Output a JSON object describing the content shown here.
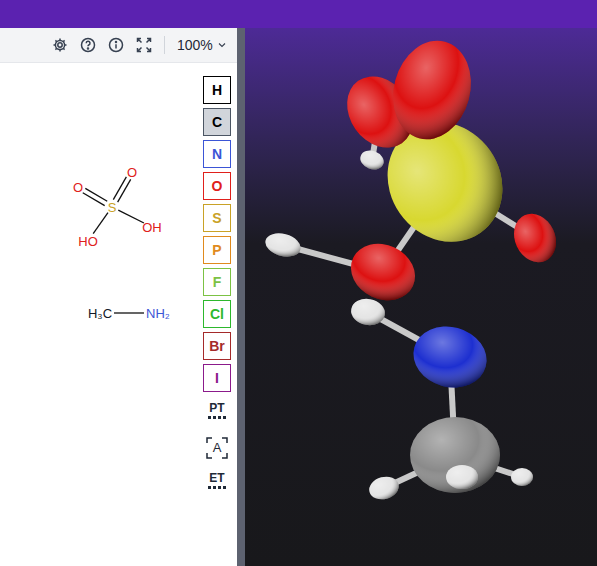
{
  "toolbar": {
    "zoom": "100%"
  },
  "structures": [
    {
      "atoms": [
        {
          "label": "S",
          "color": "#c9a227"
        },
        {
          "label": "O",
          "color": "#e0201b"
        },
        {
          "label": "O",
          "color": "#e0201b"
        },
        {
          "label": "OH",
          "color": "#e0201b"
        },
        {
          "label": "HO",
          "color": "#e0201b"
        }
      ],
      "bonds": [
        {
          "from": 0,
          "to": 1,
          "kind": "double"
        },
        {
          "from": 0,
          "to": 2,
          "kind": "double"
        },
        {
          "from": 0,
          "to": 3,
          "kind": "single"
        },
        {
          "from": 0,
          "to": 4,
          "kind": "single"
        }
      ]
    },
    {
      "atoms": [
        {
          "label": "H₃C",
          "color": "#111827"
        },
        {
          "label": "NH₂",
          "color": "#3b55d6"
        }
      ],
      "bonds": [
        {
          "from": 0,
          "to": 1,
          "kind": "single"
        }
      ]
    }
  ],
  "palette": [
    {
      "label": "H",
      "color": "#000000",
      "selected": false
    },
    {
      "label": "C",
      "color": "#000000",
      "selected": true
    },
    {
      "label": "N",
      "color": "#3b55d6",
      "selected": false
    },
    {
      "label": "O",
      "color": "#e0201b",
      "selected": false
    },
    {
      "label": "S",
      "color": "#c9a227",
      "selected": false
    },
    {
      "label": "P",
      "color": "#e08a1e",
      "selected": false
    },
    {
      "label": "F",
      "color": "#7cc244",
      "selected": false
    },
    {
      "label": "Cl",
      "color": "#2db82d",
      "selected": false
    },
    {
      "label": "Br",
      "color": "#a52a2a",
      "selected": false
    },
    {
      "label": "I",
      "color": "#8b1a8b",
      "selected": false
    }
  ],
  "tools": [
    {
      "label": "PT",
      "kind": "table"
    },
    {
      "label": "A",
      "kind": "bracket"
    },
    {
      "label": "ET",
      "kind": "table"
    }
  ],
  "viewer": {
    "atoms": [
      {
        "color": "#d8d830"
      },
      {
        "color": "#dd1111"
      },
      {
        "color": "#dd1111"
      },
      {
        "color": "#dd1111"
      },
      {
        "color": "#dd1111"
      },
      {
        "color": "#e5e5e5"
      },
      {
        "color": "#e5e5e5"
      },
      {
        "color": "#e5e5e5"
      },
      {
        "color": "#1d2fd0"
      },
      {
        "color": "#8a8a8a"
      },
      {
        "color": "#e5e5e5"
      },
      {
        "color": "#e5e5e5"
      },
      {
        "color": "#e5e5e5"
      }
    ]
  }
}
